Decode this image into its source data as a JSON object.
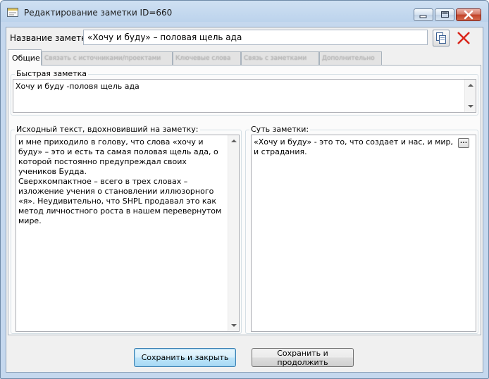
{
  "window": {
    "title": "Редактирование заметки ID=660"
  },
  "note_name": {
    "label": "Название заметки:",
    "value": "«Хочу и буду» – половая щель ада"
  },
  "tabs": [
    {
      "label": "Общие",
      "active": true
    },
    {
      "label": "Связать с источниками/проектами",
      "active": false
    },
    {
      "label": "Ключевые слова",
      "active": false
    },
    {
      "label": "Связь с заметками",
      "active": false
    },
    {
      "label": "Дополнительно",
      "active": false
    }
  ],
  "quick_note": {
    "label": "Быстрая заметка",
    "text": "Хочу и буду -половя щель ада"
  },
  "source_text": {
    "label": "Исходный текст, вдохновивший на заметку:",
    "text": "и мне приходило в голову, что слова «хочу и\nбуду» – это и есть та самая половая щель ада, о\nкоторой постоянно предупреждал своих\nучеников Будда.\nСверхкомпактное – всего в трех словах –\nизложение учения о становлении иллюзорного\n«я». Неудивительно, что SHPL продавал это как\nметод личностного роста в нашем перевернутом\nмире."
  },
  "essence": {
    "label": "Суть заметки:",
    "text": "«Хочу и буду» - это то, что создает и нас, и мир,\nи страдания.",
    "ellipsis": "..."
  },
  "buttons": {
    "save_close": "Сохранить и закрыть",
    "save_continue": "Сохранить и продолжить"
  },
  "colors": {
    "title_bar": "#bcd3ec",
    "close_button": "#c2442a",
    "delete_icon": "#d9261c",
    "default_button_border": "#3c7fb1"
  },
  "icons": {
    "app": "note-edit-icon",
    "copy": "copy-icon",
    "delete": "delete-x-icon"
  }
}
